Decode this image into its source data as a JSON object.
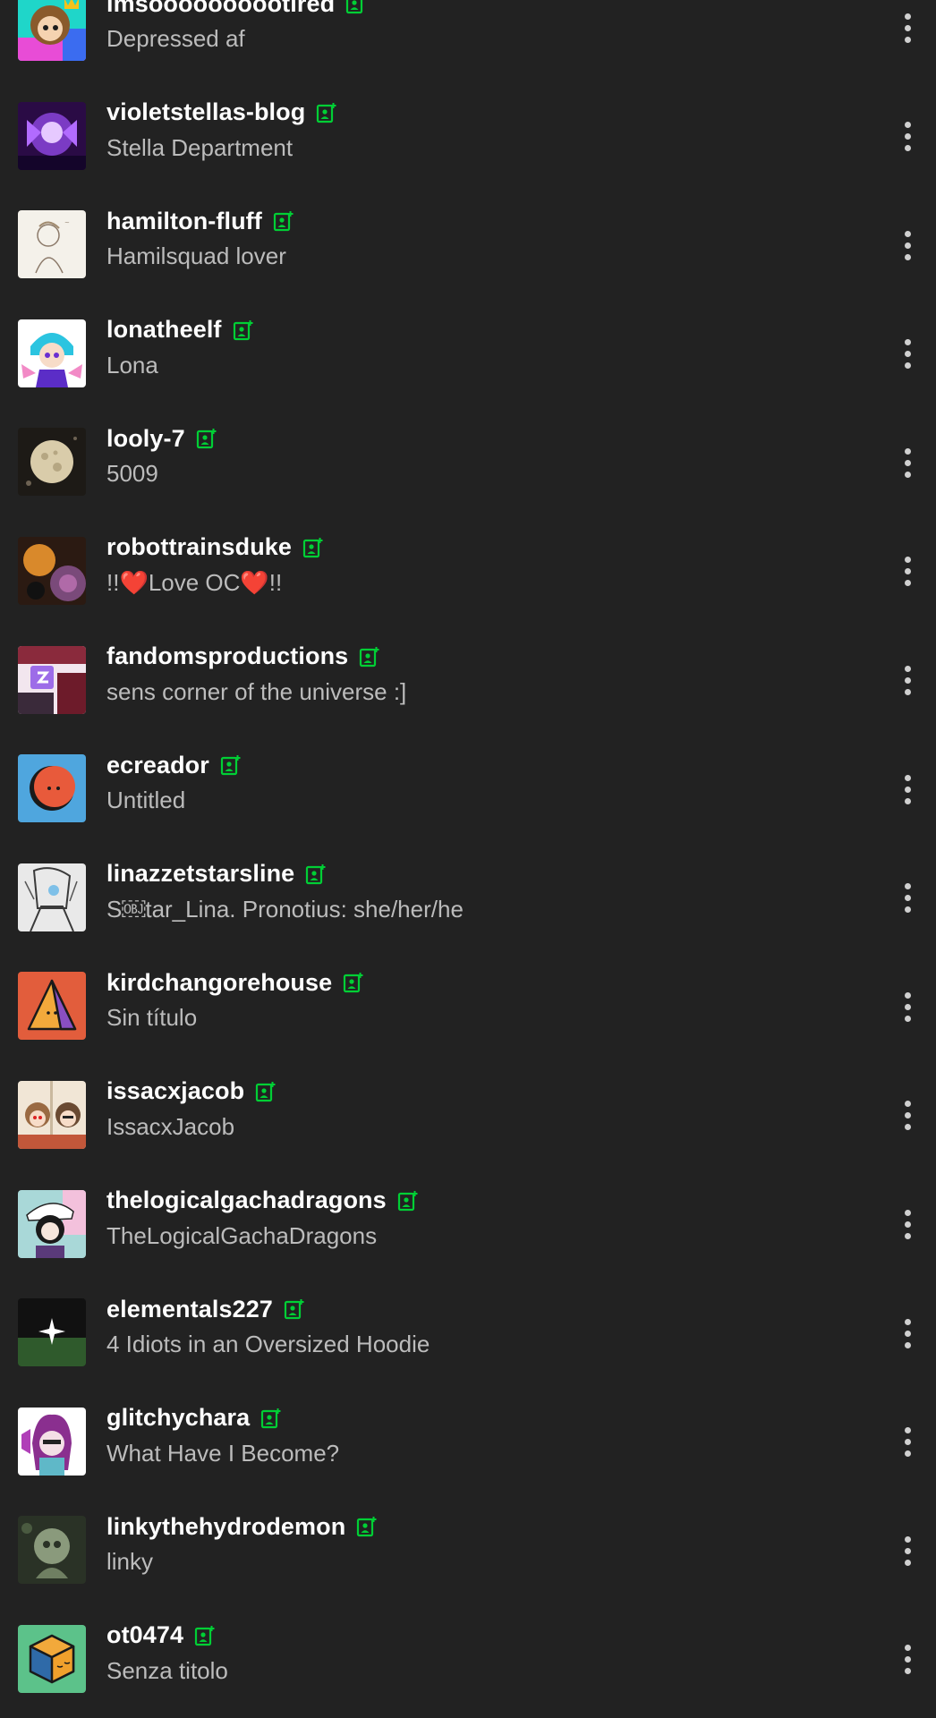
{
  "accent_color": "#00cf35",
  "background_color": "#222222",
  "blogs": [
    {
      "username": "imsoooooooootired",
      "title": "Depressed af",
      "follow_icon": "follow-blog-icon",
      "more_icon": "more-vertical-icon"
    },
    {
      "username": "violetstellas-blog",
      "title": "Stella Department",
      "follow_icon": "follow-blog-icon",
      "more_icon": "more-vertical-icon"
    },
    {
      "username": "hamilton-fluff",
      "title": "Hamilsquad lover",
      "follow_icon": "follow-blog-icon",
      "more_icon": "more-vertical-icon"
    },
    {
      "username": "lonatheelf",
      "title": "Lona",
      "follow_icon": "follow-blog-icon",
      "more_icon": "more-vertical-icon"
    },
    {
      "username": "looly-7",
      "title": "5009",
      "follow_icon": "follow-blog-icon",
      "more_icon": "more-vertical-icon"
    },
    {
      "username": "robottrainsduke",
      "title": "!!❤️Love OC❤️!!",
      "follow_icon": "follow-blog-icon",
      "more_icon": "more-vertical-icon"
    },
    {
      "username": "fandomsproductions",
      "title": "sens corner of the universe :]",
      "follow_icon": "follow-blog-icon",
      "more_icon": "more-vertical-icon"
    },
    {
      "username": "ecreador",
      "title": "Untitled",
      "follow_icon": "follow-blog-icon",
      "more_icon": "more-vertical-icon"
    },
    {
      "username": "linazzetstarsline",
      "title": "S￼tar_Lina. Pronotius: she/her/he",
      "follow_icon": "follow-blog-icon",
      "more_icon": "more-vertical-icon"
    },
    {
      "username": "kirdchangorehouse",
      "title": "Sin título",
      "follow_icon": "follow-blog-icon",
      "more_icon": "more-vertical-icon"
    },
    {
      "username": "issacxjacob",
      "title": "IssacxJacob",
      "follow_icon": "follow-blog-icon",
      "more_icon": "more-vertical-icon"
    },
    {
      "username": "thelogicalgachadragons",
      "title": "TheLogicalGachaDragons",
      "follow_icon": "follow-blog-icon",
      "more_icon": "more-vertical-icon"
    },
    {
      "username": "elementals227",
      "title": "4 Idiots in an Oversized Hoodie",
      "follow_icon": "follow-blog-icon",
      "more_icon": "more-vertical-icon"
    },
    {
      "username": "glitchychara",
      "title": "What Have I Become?",
      "follow_icon": "follow-blog-icon",
      "more_icon": "more-vertical-icon"
    },
    {
      "username": "linkythehydrodemon",
      "title": "linky",
      "follow_icon": "follow-blog-icon",
      "more_icon": "more-vertical-icon"
    },
    {
      "username": "ot0474",
      "title": "Senza titolo",
      "follow_icon": "follow-blog-icon",
      "more_icon": "more-vertical-icon"
    }
  ]
}
